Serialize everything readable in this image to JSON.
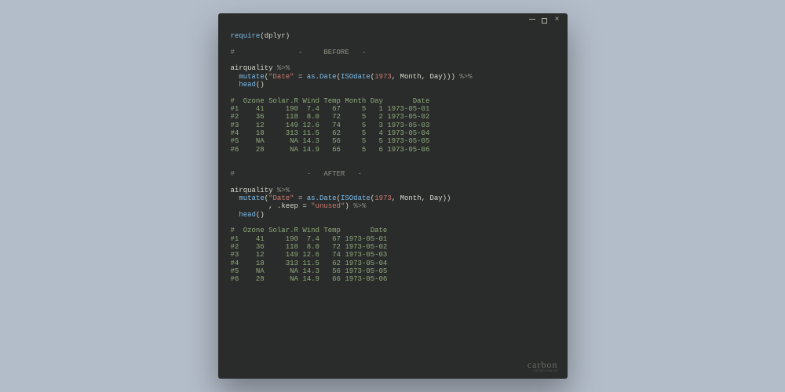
{
  "window_controls": {
    "minimize": "minimize-icon",
    "maximize": "maximize-icon",
    "close": "close-icon"
  },
  "code": {
    "l1_require": "require",
    "l1_pkg": "dplyr",
    "sep_before": "#               -     BEFORE   -",
    "block1": {
      "ds": "airquality",
      "pipe": "%>%",
      "mutate": "mutate",
      "date_key": "\"Date\"",
      "asdate": "as.Date",
      "isodate": "ISOdate",
      "year": "1973",
      "m": "Month",
      "d": "Day",
      "head": "head"
    },
    "out1_header": "#  Ozone Solar.R Wind Temp Month Day       Date",
    "out1_rows": [
      "#1    41     190  7.4   67     5   1 1973-05-01",
      "#2    36     118  8.0   72     5   2 1973-05-02",
      "#3    12     149 12.6   74     5   3 1973-05-03",
      "#4    18     313 11.5   62     5   4 1973-05-04",
      "#5    NA      NA 14.3   56     5   5 1973-05-05",
      "#6    28      NA 14.9   66     5   6 1973-05-06"
    ],
    "sep_after": "#                 -   AFTER   -",
    "block2": {
      "keep_arg": ".keep",
      "keep_val": "\"unused\""
    },
    "out2_header": "#  Ozone Solar.R Wind Temp       Date",
    "out2_rows": [
      "#1    41     190  7.4   67 1973-05-01",
      "#2    36     118  8.0   72 1973-05-02",
      "#3    12     149 12.6   74 1973-05-03",
      "#4    18     313 11.5   62 1973-05-04",
      "#5    NA      NA 14.3   56 1973-05-05",
      "#6    28      NA 14.9   66 1973-05-06"
    ]
  },
  "watermark": {
    "main": "carbon",
    "sub": "carbon.now.sh"
  }
}
